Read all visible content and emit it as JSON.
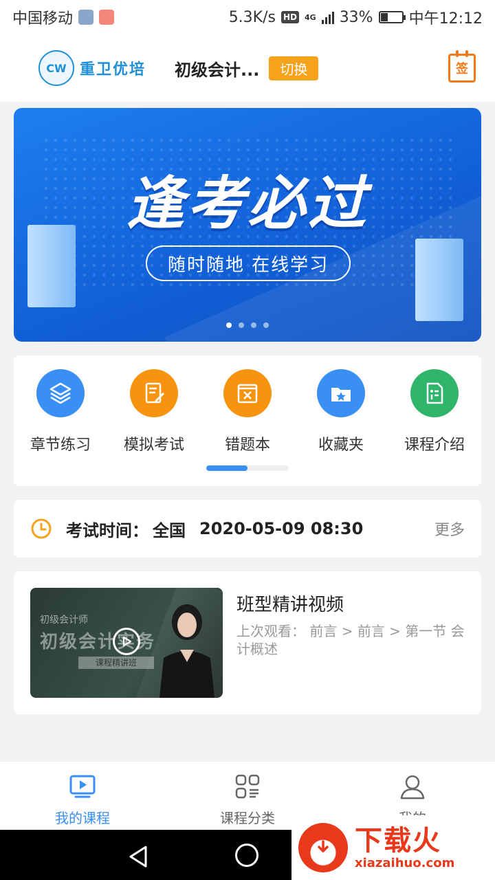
{
  "status_bar": {
    "carrier": "中国移动",
    "speed": "5.3K/s",
    "hd": "HD",
    "network": "4G",
    "battery": "33%",
    "battery_level": 0.33,
    "time": "中午12:12"
  },
  "header": {
    "brand": "重卫优培",
    "course": "初级会计...",
    "switch_label": "切换",
    "checkin_label": "签"
  },
  "banner": {
    "title": "逢考必过",
    "subtitle": "随时随地  在线学习",
    "slide_count": 4,
    "active_slide": 1
  },
  "menu": {
    "items": [
      {
        "label": "章节练习",
        "icon": "layers-icon",
        "color": "#3a8ff5"
      },
      {
        "label": "模拟考试",
        "icon": "exam-paper-icon",
        "color": "#f7930f"
      },
      {
        "label": "错题本",
        "icon": "wrong-book-icon",
        "color": "#f7930f"
      },
      {
        "label": "收藏夹",
        "icon": "favorite-folder-icon",
        "color": "#3a8ff5"
      },
      {
        "label": "课程介绍",
        "icon": "course-info-icon",
        "color": "#2fb56a"
      }
    ],
    "page_progress": 0.5
  },
  "exam": {
    "label": "考试时间：",
    "region": "全国",
    "date": "2020-05-09 08:30",
    "more": "更多"
  },
  "video": {
    "title": "班型精讲视频",
    "history": "上次观看：  前言 > 前言 > 第一节 会计概述",
    "thumb_small": "初级会计师",
    "thumb_big": "初级会计实务",
    "thumb_bar": "课程精讲班"
  },
  "tabbar": {
    "tabs": [
      {
        "label": "我的课程",
        "icon": "play-screen-icon",
        "active": true
      },
      {
        "label": "课程分类",
        "icon": "grid-list-icon",
        "active": false
      },
      {
        "label": "我的",
        "icon": "user-icon",
        "active": false
      }
    ]
  },
  "watermark": {
    "text": "下载火",
    "url": "xiazaihuo.com"
  },
  "colors": {
    "accent": "#3a8ff5",
    "orange": "#f7a21b",
    "banner_blue": "#1d7ff0"
  }
}
